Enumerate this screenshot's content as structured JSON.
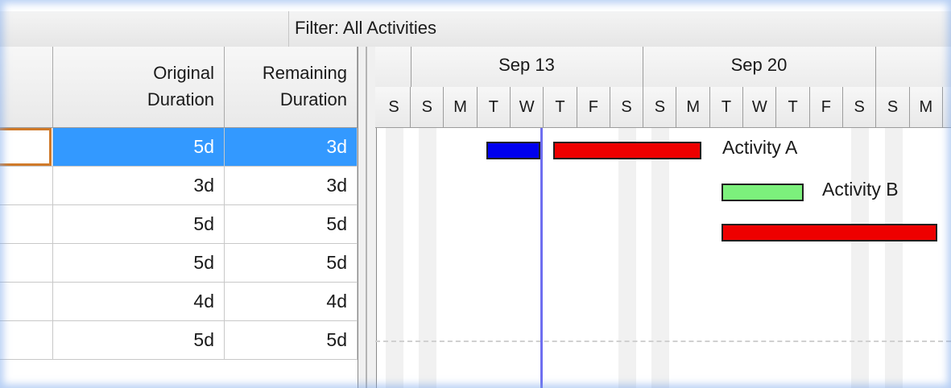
{
  "filter": {
    "label": "Filter: All Activities"
  },
  "columns": [
    {
      "line1": "Original",
      "line2": "Duration"
    },
    {
      "line1": "Remaining",
      "line2": "Duration"
    }
  ],
  "rows": [
    {
      "original": "5d",
      "remaining": "3d",
      "selected": true
    },
    {
      "original": "3d",
      "remaining": "3d",
      "selected": false
    },
    {
      "original": "5d",
      "remaining": "5d",
      "selected": false
    },
    {
      "original": "5d",
      "remaining": "5d",
      "selected": false
    },
    {
      "original": "4d",
      "remaining": "4d",
      "selected": false
    },
    {
      "original": "5d",
      "remaining": "5d",
      "selected": false
    }
  ],
  "timescale": {
    "weeks": [
      "Sep 13",
      "Sep 20"
    ],
    "days": [
      "S",
      "S",
      "M",
      "T",
      "W",
      "T",
      "F",
      "S",
      "S",
      "M",
      "T",
      "W",
      "T",
      "F",
      "S",
      "S",
      "M"
    ]
  },
  "bars": [
    {
      "label": "",
      "color": "#0000ee"
    },
    {
      "label": "Activity A",
      "color": "#ee0000"
    },
    {
      "label": "Activity B",
      "color": "#7cf07c"
    },
    {
      "label": "",
      "color": "#ee0000"
    }
  ],
  "colors": {
    "selection": "#3399ff",
    "data_date_line": "#6f6ff0",
    "nonwork_shading": "#f1f1f1"
  }
}
